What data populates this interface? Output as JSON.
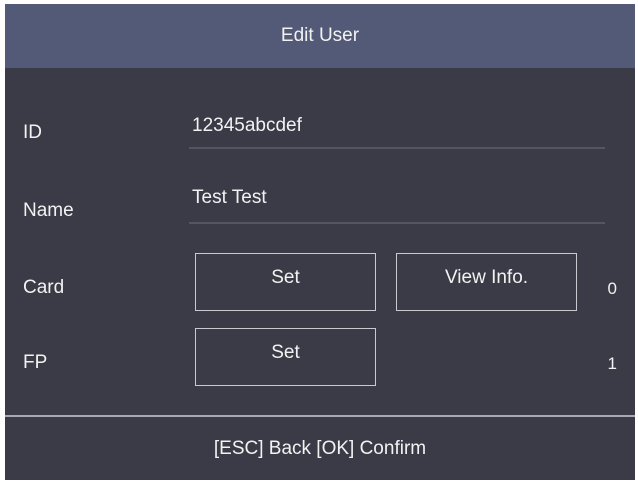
{
  "title": "Edit User",
  "fields": {
    "id": {
      "label": "ID",
      "value": "12345abcdef"
    },
    "name": {
      "label": "Name",
      "value": "Test Test"
    },
    "card": {
      "label": "Card",
      "set_label": "Set",
      "view_label": "View Info.",
      "count": "0"
    },
    "fp": {
      "label": "FP",
      "set_label": "Set",
      "count": "1"
    }
  },
  "footer": {
    "hint": "[ESC] Back [OK] Confirm"
  },
  "colors": {
    "titlebar": "#525a77",
    "background": "#3b3b47",
    "text": "#f2f2f2",
    "button_border": "#c9c9cf"
  }
}
